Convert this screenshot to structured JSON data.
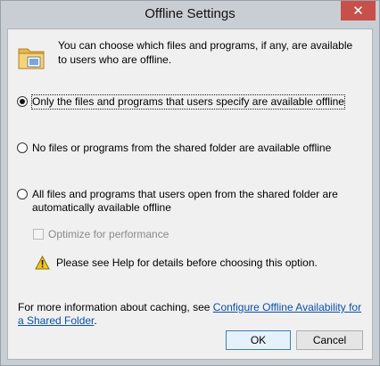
{
  "window": {
    "title": "Offline Settings",
    "close_glyph": "✕"
  },
  "intro": {
    "text": "You can choose which files and programs, if any, are available to users who are offline."
  },
  "icons": {
    "folder": "folder-icon",
    "warning": "warning-icon",
    "close": "close-icon"
  },
  "options": [
    {
      "label": "Only the files and programs that users specify are available offline",
      "checked": true
    },
    {
      "label": "No files or programs from the shared folder are available offline",
      "checked": false
    },
    {
      "label": "All files and programs that users open from the shared folder are automatically available offline",
      "checked": false
    }
  ],
  "optimize": {
    "label": "Optimize for performance",
    "checked": false,
    "enabled": false
  },
  "warning": {
    "text": "Please see Help for details before choosing this option."
  },
  "info": {
    "prefix": "For more information about caching, see ",
    "link": "Configure Offline Availability for a Shared Folder",
    "suffix": "."
  },
  "buttons": {
    "ok": "OK",
    "cancel": "Cancel"
  },
  "colors": {
    "link": "#0b50a8",
    "close": "#c7504a",
    "dialog_bg": "#f0f0f0",
    "frame": "#c9ced4"
  }
}
